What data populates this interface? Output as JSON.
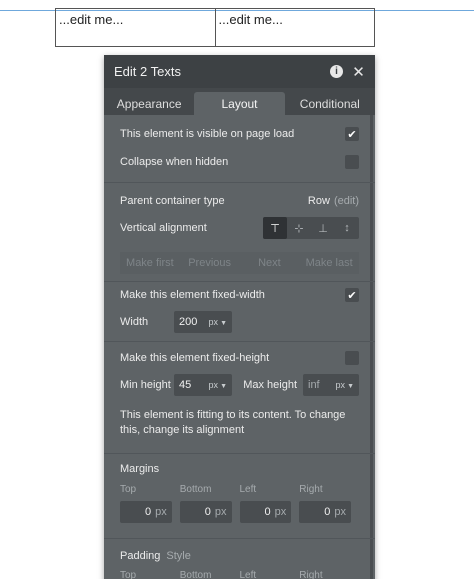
{
  "canvas": {
    "cells": [
      "...edit me...",
      "...edit me..."
    ]
  },
  "panel": {
    "title": "Edit 2 Texts",
    "tabs": [
      "Appearance",
      "Layout",
      "Conditional"
    ],
    "active_tab": "Layout",
    "visible_on_load": {
      "label": "This element is visible on page load",
      "checked": true
    },
    "collapse_hidden": {
      "label": "Collapse when hidden",
      "checked": false
    },
    "parent_container": {
      "label": "Parent container type",
      "value": "Row",
      "edit": "(edit)"
    },
    "vertical_alignment": {
      "label": "Vertical alignment"
    },
    "order_buttons": [
      "Make first",
      "Previous",
      "Next",
      "Make last"
    ],
    "fixed_width": {
      "label": "Make this element fixed-width",
      "checked": true
    },
    "width": {
      "label": "Width",
      "value": "200",
      "unit": "px"
    },
    "fixed_height": {
      "label": "Make this element fixed-height",
      "checked": false
    },
    "min_height": {
      "label": "Min height",
      "value": "45",
      "unit": "px"
    },
    "max_height": {
      "label": "Max height",
      "placeholder": "inf",
      "unit": "px"
    },
    "hint": "This element is fitting to its content. To change this, change its alignment",
    "margins": {
      "title": "Margins",
      "sides": [
        "Top",
        "Bottom",
        "Left",
        "Right"
      ],
      "values": [
        "0",
        "0",
        "0",
        "0"
      ],
      "unit": "px"
    },
    "padding": {
      "title": "Padding",
      "style_link": "Style",
      "sides": [
        "Top",
        "Bottom",
        "Left",
        "Right"
      ]
    }
  }
}
